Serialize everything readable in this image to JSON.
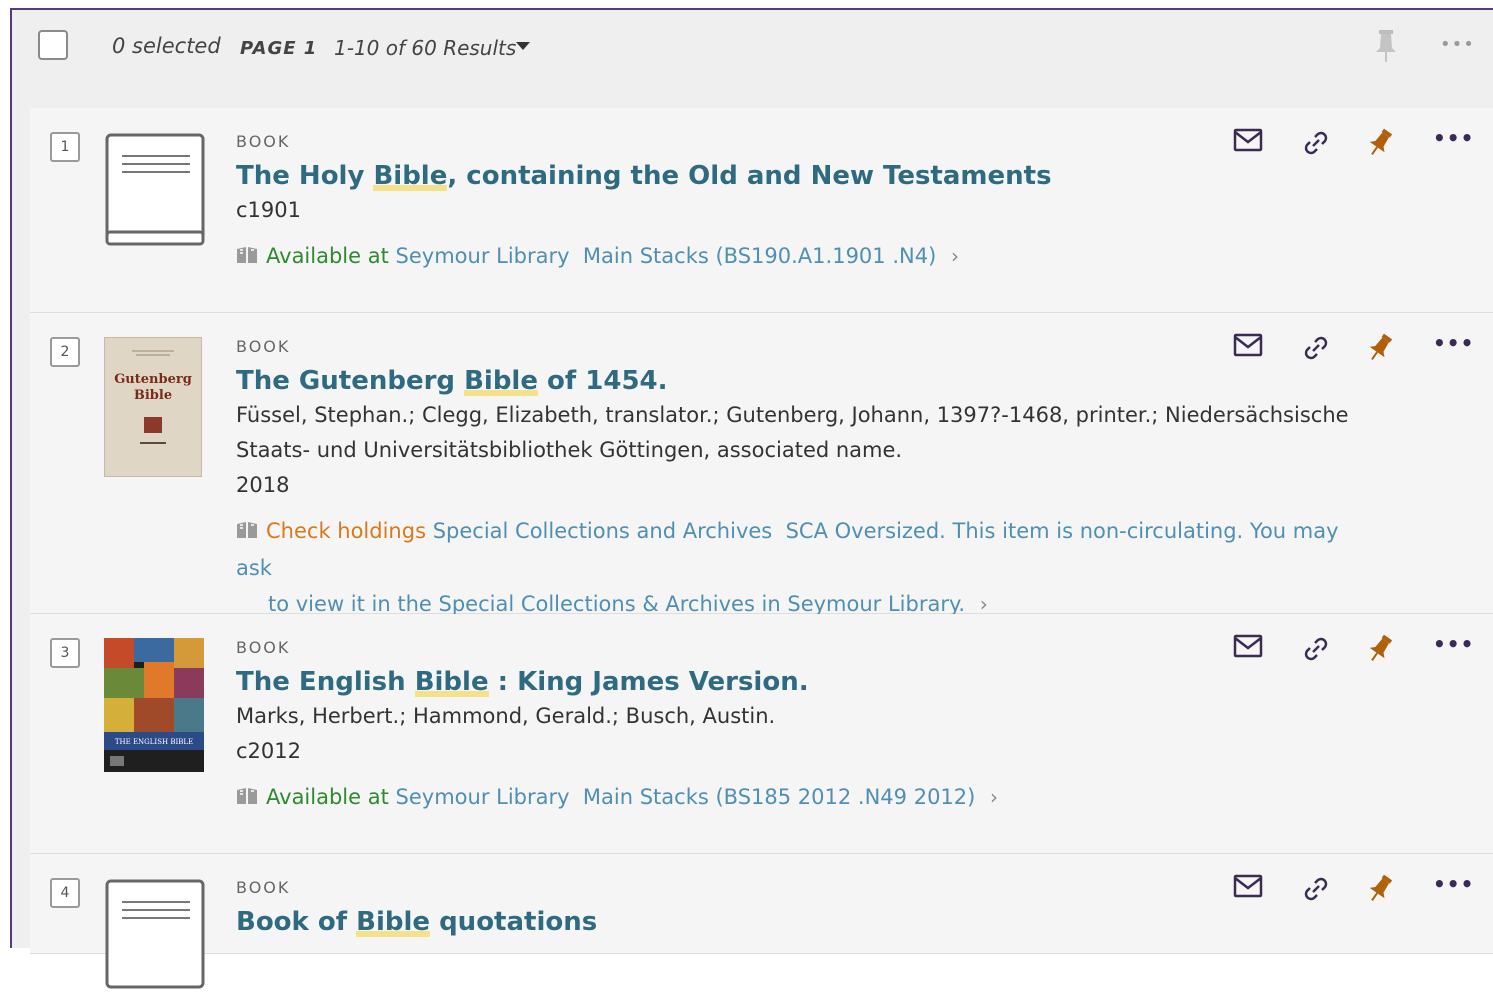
{
  "toolbar": {
    "selected": "0 selected",
    "page": "PAGE 1",
    "results": "1-10 of 60 Results"
  },
  "icons": {
    "pin": "pin-icon",
    "more": "more-icon",
    "mail": "mail-icon",
    "link": "link-icon",
    "book": "book-open-icon"
  },
  "colors": {
    "title": "#2e6a80",
    "available": "#2e8a2e",
    "check_holdings": "#d9791a",
    "location": "#4f8fb3",
    "pin_active": "#b0600b",
    "frame_border": "#5b3a7c"
  },
  "results": [
    {
      "num": "1",
      "type": "BOOK",
      "title_pre": "The Holy ",
      "title_hl": "Bible",
      "title_post": ", containing the Old and New Testaments",
      "authors": "",
      "date": "c1901",
      "status": "Available at",
      "library": "Seymour Library",
      "location": "Main Stacks (BS190.A1.1901 .N4)",
      "cover": "placeholder-book"
    },
    {
      "num": "2",
      "type": "BOOK",
      "title_pre": "The Gutenberg ",
      "title_hl": "Bible",
      "title_post": " of 1454.",
      "authors_line1": "Füssel, Stephan.; Clegg, Elizabeth, translator.; Gutenberg, Johann, 1397?-1468, printer.; Niedersächsische",
      "authors_line2": "Staats- und Universitätsbibliothek Göttingen, associated name.",
      "date": "2018",
      "status": "Check holdings",
      "library": "Special Collections and Archives",
      "location_line1": "SCA Oversized. This item is non-circulating. You may ask",
      "location_line2": "to view it in the Special Collections & Archives in Seymour Library.",
      "cover": "gutenberg-cover",
      "cover_text": "Gutenberg Bible"
    },
    {
      "num": "3",
      "type": "BOOK",
      "title_pre": "The English ",
      "title_hl": "Bible",
      "title_post": " : King James Version.",
      "authors": "Marks, Herbert.; Hammond, Gerald.; Busch, Austin.",
      "date": "c2012",
      "status": "Available at",
      "library": "Seymour Library",
      "location": "Main Stacks (BS185 2012 .N49 2012)",
      "cover": "english-bible-cover",
      "cover_text": "THE ENGLISH BIBLE"
    },
    {
      "num": "4",
      "type": "BOOK",
      "title_pre": "Book of ",
      "title_hl": "Bible",
      "title_post": " quotations",
      "cover": "placeholder-book"
    }
  ]
}
